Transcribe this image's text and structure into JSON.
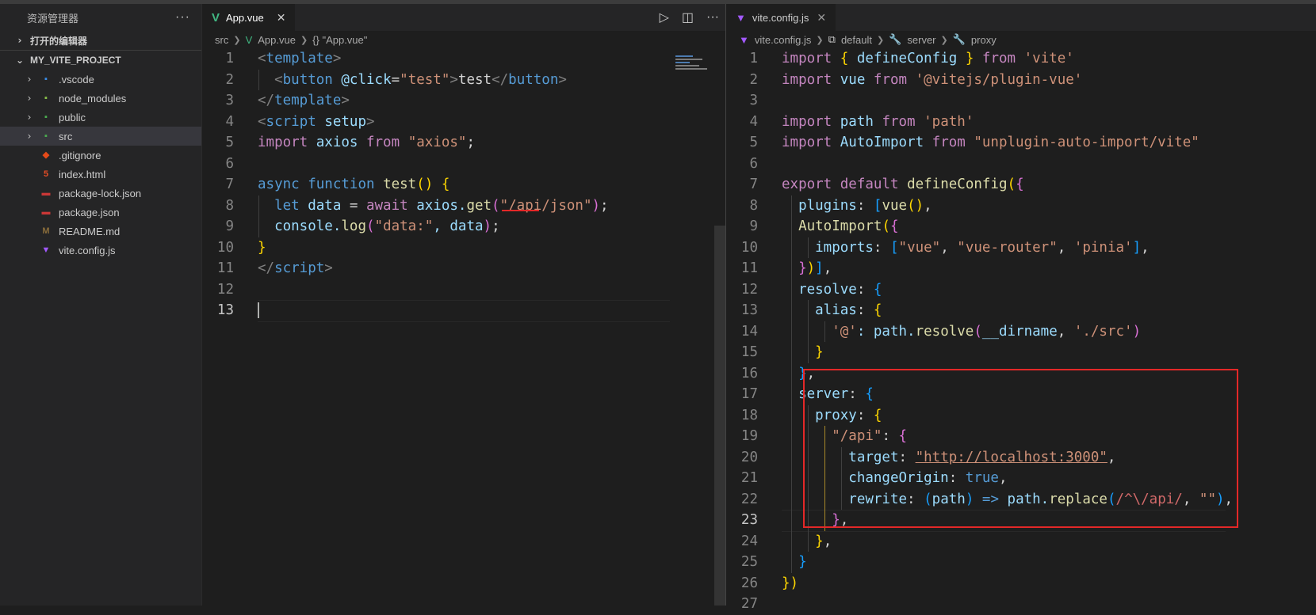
{
  "explorer": {
    "title": "资源管理器",
    "more": "···",
    "open_editors": "打开的编辑器",
    "project": "MY_VITE_PROJECT",
    "items": [
      {
        "label": ".vscode",
        "type": "folder",
        "icon": "vscode-folder-icon",
        "color": "#3b8eea",
        "glyph": "▪"
      },
      {
        "label": "node_modules",
        "type": "folder",
        "icon": "node-folder-icon",
        "color": "#8bc34a",
        "glyph": "▪"
      },
      {
        "label": "public",
        "type": "folder",
        "icon": "public-folder-icon",
        "color": "#4caf50",
        "glyph": "▪"
      },
      {
        "label": "src",
        "type": "folder",
        "icon": "src-folder-icon",
        "color": "#4caf50",
        "glyph": "▪"
      },
      {
        "label": ".gitignore",
        "type": "file",
        "icon": "git-icon",
        "color": "#e64a19",
        "glyph": "◆"
      },
      {
        "label": "index.html",
        "type": "file",
        "icon": "html5-icon",
        "color": "#e44d26",
        "glyph": "5"
      },
      {
        "label": "package-lock.json",
        "type": "file",
        "icon": "npm-icon",
        "color": "#cb3837",
        "glyph": "▬"
      },
      {
        "label": "package.json",
        "type": "file",
        "icon": "npm-icon",
        "color": "#cb3837",
        "glyph": "▬"
      },
      {
        "label": "README.md",
        "type": "file",
        "icon": "markdown-icon",
        "color": "#8a6d3b",
        "glyph": "M"
      },
      {
        "label": "vite.config.js",
        "type": "file",
        "icon": "vite-icon",
        "color": "#a259ff",
        "glyph": "▼"
      }
    ]
  },
  "left_editor": {
    "tab": {
      "label": "App.vue",
      "close": "✕",
      "icon": "vue-icon"
    },
    "actions": {
      "run": "▷",
      "split": "◫",
      "more": "···"
    },
    "breadcrumb": [
      "src",
      "App.vue",
      "{} \"App.vue\""
    ],
    "line_numbers": [
      "1",
      "2",
      "3",
      "4",
      "5",
      "6",
      "7",
      "8",
      "9",
      "10",
      "11",
      "12",
      "13"
    ],
    "lines": [
      [
        [
          "<",
          "br"
        ],
        [
          "template",
          "tag"
        ],
        [
          ">",
          "br"
        ]
      ],
      [
        [
          "  ",
          "w"
        ],
        [
          "<",
          "br"
        ],
        [
          "button",
          "tag"
        ],
        [
          " ",
          "w"
        ],
        [
          "@click",
          "var"
        ],
        [
          "=",
          "w"
        ],
        [
          "\"test\"",
          "str"
        ],
        [
          ">",
          "br"
        ],
        [
          "test",
          "w"
        ],
        [
          "</",
          "br"
        ],
        [
          "button",
          "tag"
        ],
        [
          ">",
          "br"
        ]
      ],
      [
        [
          "</",
          "br"
        ],
        [
          "template",
          "tag"
        ],
        [
          ">",
          "br"
        ]
      ],
      [
        [
          "<",
          "br"
        ],
        [
          "script",
          "tag"
        ],
        [
          " ",
          "w"
        ],
        [
          "setup",
          "var"
        ],
        [
          ">",
          "br"
        ]
      ],
      [
        [
          "import",
          "kw2"
        ],
        [
          " axios ",
          "var"
        ],
        [
          "from",
          "kw2"
        ],
        [
          " ",
          "w"
        ],
        [
          "\"axios\"",
          "str"
        ],
        [
          ";",
          "w"
        ]
      ],
      [],
      [
        [
          "async",
          "kw"
        ],
        [
          " ",
          "w"
        ],
        [
          "function",
          "kw"
        ],
        [
          " ",
          "w"
        ],
        [
          "test",
          "fn"
        ],
        [
          "()",
          "y"
        ],
        [
          " ",
          "w"
        ],
        [
          "{",
          "y"
        ]
      ],
      [
        [
          "  ",
          "w"
        ],
        [
          "let",
          "kw"
        ],
        [
          " data ",
          "var"
        ],
        [
          "= ",
          "w"
        ],
        [
          "await",
          "kw2"
        ],
        [
          " axios.",
          "var"
        ],
        [
          "get",
          "fn"
        ],
        [
          "(",
          "p"
        ],
        [
          "\"/api/json\"",
          "str"
        ],
        [
          ")",
          "p"
        ],
        [
          ";",
          "w"
        ]
      ],
      [
        [
          "  ",
          "w"
        ],
        [
          "console.",
          "var"
        ],
        [
          "log",
          "fn"
        ],
        [
          "(",
          "p"
        ],
        [
          "\"data:\"",
          "str"
        ],
        [
          ", data",
          "var"
        ],
        [
          ")",
          "p"
        ],
        [
          ";",
          "w"
        ]
      ],
      [
        [
          "}",
          "y"
        ]
      ],
      [
        [
          "</",
          "br"
        ],
        [
          "script",
          "tag"
        ],
        [
          ">",
          "br"
        ]
      ],
      [],
      []
    ]
  },
  "right_editor": {
    "tab": {
      "label": "vite.config.js",
      "close": "✕",
      "icon": "vite-icon"
    },
    "breadcrumb": [
      "vite.config.js",
      "default",
      "server",
      "proxy"
    ],
    "line_numbers": [
      "1",
      "2",
      "3",
      "4",
      "5",
      "6",
      "7",
      "8",
      "9",
      "10",
      "11",
      "12",
      "13",
      "14",
      "15",
      "16",
      "17",
      "18",
      "19",
      "20",
      "21",
      "22",
      "23",
      "24",
      "25",
      "26",
      "27"
    ],
    "lines": [
      [
        [
          "import",
          "kw2"
        ],
        [
          " ",
          "w"
        ],
        [
          "{",
          "y"
        ],
        [
          " defineConfig ",
          "var"
        ],
        [
          "}",
          "y"
        ],
        [
          " ",
          "w"
        ],
        [
          "from",
          "kw2"
        ],
        [
          " ",
          "w"
        ],
        [
          "'vite'",
          "str"
        ]
      ],
      [
        [
          "import",
          "kw2"
        ],
        [
          " vue ",
          "var"
        ],
        [
          "from",
          "kw2"
        ],
        [
          " ",
          "w"
        ],
        [
          "'@vitejs/plugin-vue'",
          "str"
        ]
      ],
      [],
      [
        [
          "import",
          "kw2"
        ],
        [
          " path ",
          "var"
        ],
        [
          "from",
          "kw2"
        ],
        [
          " ",
          "w"
        ],
        [
          "'path'",
          "str"
        ]
      ],
      [
        [
          "import",
          "kw2"
        ],
        [
          " AutoImport ",
          "var"
        ],
        [
          "from",
          "kw2"
        ],
        [
          " ",
          "w"
        ],
        [
          "\"unplugin-auto-import/vite\"",
          "str"
        ]
      ],
      [],
      [
        [
          "export",
          "kw2"
        ],
        [
          " ",
          "w"
        ],
        [
          "default",
          "kw2"
        ],
        [
          " ",
          "w"
        ],
        [
          "defineConfig",
          "fn"
        ],
        [
          "(",
          "y"
        ],
        [
          "{",
          "p"
        ]
      ],
      [
        [
          "  plugins",
          "var"
        ],
        [
          ": ",
          "w"
        ],
        [
          "[",
          "b"
        ],
        [
          "vue",
          "fn"
        ],
        [
          "()",
          "y"
        ],
        [
          ", ",
          "w"
        ]
      ],
      [
        [
          "  ",
          "w"
        ],
        [
          "AutoImport",
          "fn"
        ],
        [
          "(",
          "y"
        ],
        [
          "{",
          "p"
        ]
      ],
      [
        [
          "    imports",
          "var"
        ],
        [
          ": ",
          "w"
        ],
        [
          "[",
          "b"
        ],
        [
          "\"vue\"",
          "str"
        ],
        [
          ", ",
          "w"
        ],
        [
          "\"vue-router\"",
          "str"
        ],
        [
          ", ",
          "w"
        ],
        [
          "'pinia'",
          "str"
        ],
        [
          "]",
          "b"
        ],
        [
          ",",
          "w"
        ]
      ],
      [
        [
          "  ",
          "w"
        ],
        [
          "}",
          "p"
        ],
        [
          ")",
          "y"
        ],
        [
          "]",
          "b"
        ],
        [
          ",",
          "w"
        ]
      ],
      [
        [
          "  resolve",
          "var"
        ],
        [
          ": ",
          "w"
        ],
        [
          "{",
          "b"
        ]
      ],
      [
        [
          "    alias",
          "var"
        ],
        [
          ": ",
          "w"
        ],
        [
          "{",
          "y"
        ]
      ],
      [
        [
          "      ",
          "w"
        ],
        [
          "'@'",
          "str"
        ],
        [
          ": path.",
          "var"
        ],
        [
          "resolve",
          "fn"
        ],
        [
          "(",
          "p"
        ],
        [
          "__dirname",
          "var"
        ],
        [
          ", ",
          "w"
        ],
        [
          "'./src'",
          "str"
        ],
        [
          ")",
          "p"
        ]
      ],
      [
        [
          "    ",
          "w"
        ],
        [
          "}",
          "y"
        ]
      ],
      [
        [
          "  ",
          "w"
        ],
        [
          "}",
          "b"
        ],
        [
          ",",
          "w"
        ]
      ],
      [
        [
          "  server",
          "var"
        ],
        [
          ": ",
          "w"
        ],
        [
          "{",
          "b"
        ]
      ],
      [
        [
          "    proxy",
          "var"
        ],
        [
          ": ",
          "w"
        ],
        [
          "{",
          "y"
        ]
      ],
      [
        [
          "      ",
          "w"
        ],
        [
          "\"/api\"",
          "str"
        ],
        [
          ": ",
          "w"
        ],
        [
          "{",
          "p"
        ]
      ],
      [
        [
          "        target",
          "var"
        ],
        [
          ": ",
          "w"
        ],
        [
          "\"http://localhost:3000\"",
          "str"
        ],
        [
          ",",
          "w"
        ]
      ],
      [
        [
          "        changeOrigin",
          "var"
        ],
        [
          ": ",
          "w"
        ],
        [
          "true",
          "kw"
        ],
        [
          ",",
          "w"
        ]
      ],
      [
        [
          "        rewrite",
          "var"
        ],
        [
          ": ",
          "w"
        ],
        [
          "(",
          "b"
        ],
        [
          "path",
          "var"
        ],
        [
          ")",
          "b"
        ],
        [
          " ",
          "w"
        ],
        [
          "=>",
          "kw"
        ],
        [
          " path.",
          "var"
        ],
        [
          "replace",
          "fn"
        ],
        [
          "(",
          "b"
        ],
        [
          "/^\\/api/",
          "reg"
        ],
        [
          ", ",
          "w"
        ],
        [
          "\"\"",
          "str"
        ],
        [
          ")",
          "b"
        ],
        [
          ",",
          "w"
        ]
      ],
      [
        [
          "      ",
          "w"
        ],
        [
          "}",
          "p"
        ],
        [
          ",",
          "w"
        ]
      ],
      [
        [
          "    ",
          "w"
        ],
        [
          "}",
          "y"
        ],
        [
          ",",
          "w"
        ]
      ],
      [
        [
          "  ",
          "w"
        ],
        [
          "}",
          "b"
        ]
      ],
      [
        [
          "}",
          "y"
        ],
        [
          ")",
          "y"
        ]
      ],
      []
    ]
  }
}
